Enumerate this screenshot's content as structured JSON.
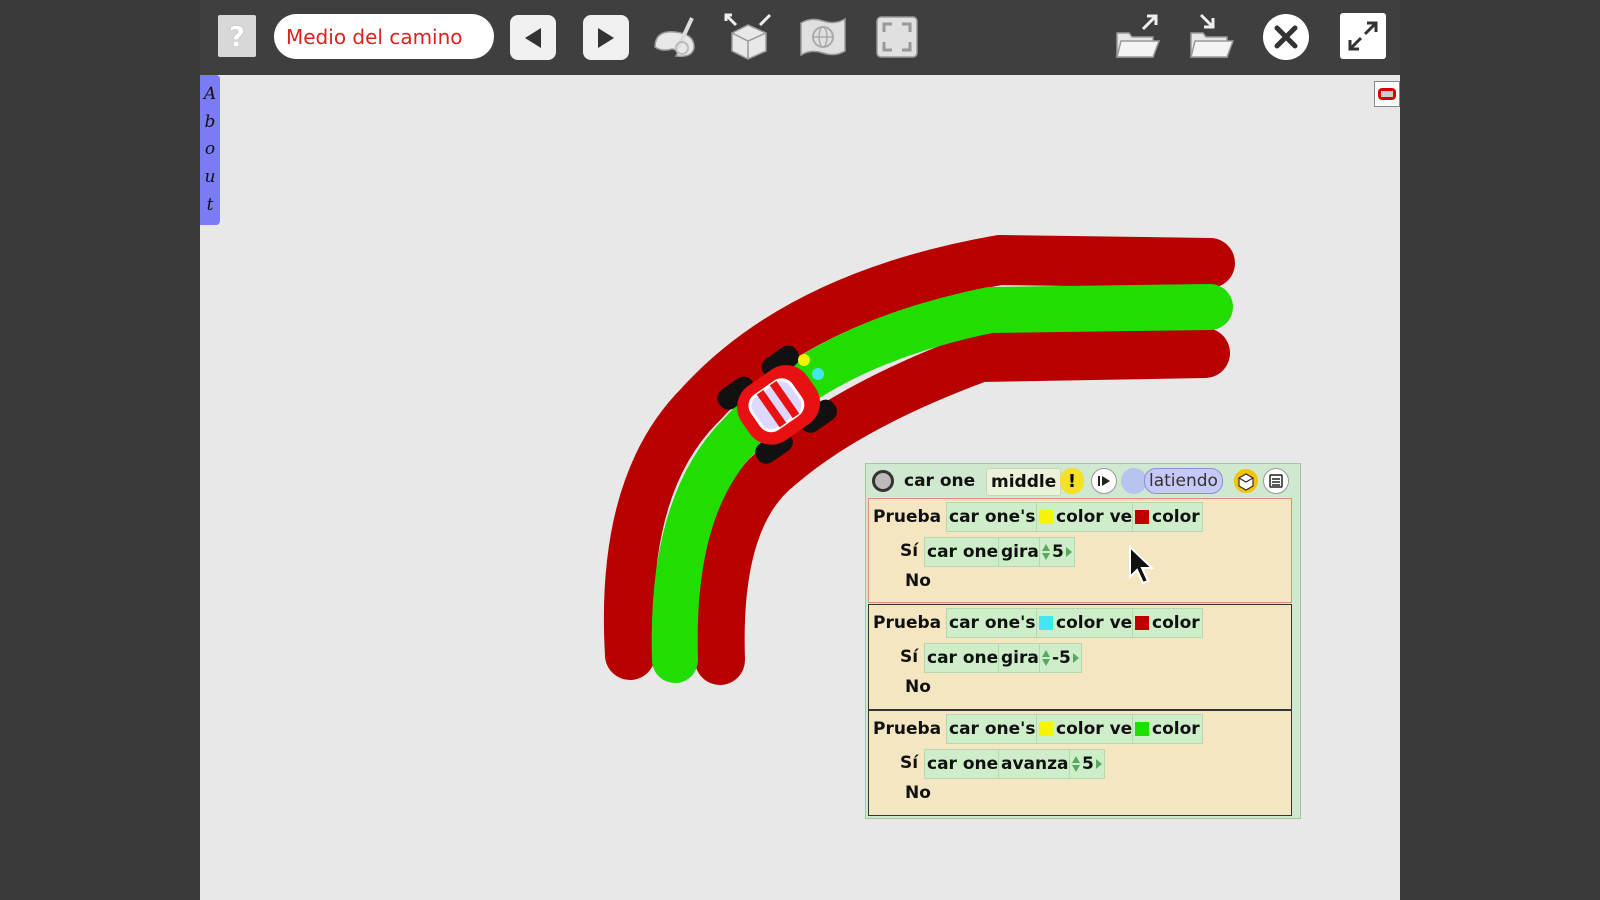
{
  "toolbar": {
    "help_label": "?",
    "project_title": "Medio del camino"
  },
  "world": {
    "about_letters": [
      "A",
      "b",
      "o",
      "u",
      "t"
    ]
  },
  "colors": {
    "road_border": "#b80000",
    "road_center": "#22dd00",
    "sensor_yellow": "#f5f500",
    "sensor_cyan": "#44e6f0",
    "swatch_red": "#c00000",
    "swatch_green": "#22dd00"
  },
  "viewer": {
    "name": "car one",
    "variant": "middle",
    "warning": "!",
    "status": "latiendo",
    "tests": [
      {
        "test_label": "Prueba",
        "cond_subject": "car one's",
        "cond_color": "color ve",
        "cond_color_swatch": "yellow",
        "cond_target": "color",
        "cond_target_swatch": "red",
        "yes_label": "Sí",
        "yes_object": "car one",
        "yes_command": "gira",
        "yes_value": "5",
        "no_label": "No"
      },
      {
        "test_label": "Prueba",
        "cond_subject": "car one's",
        "cond_color": "color ve",
        "cond_color_swatch": "cyan",
        "cond_target": "color",
        "cond_target_swatch": "red",
        "yes_label": "Sí",
        "yes_object": "car one",
        "yes_command": "gira",
        "yes_value": "-5",
        "no_label": "No"
      },
      {
        "test_label": "Prueba",
        "cond_subject": "car one's",
        "cond_color": "color ve",
        "cond_color_swatch": "yellow",
        "cond_target": "color",
        "cond_target_swatch": "green",
        "yes_label": "Sí",
        "yes_object": "car one",
        "yes_command": "avanza",
        "yes_value": "5",
        "no_label": "No"
      }
    ]
  },
  "icons": [
    "help-icon",
    "back-arrow-icon",
    "forward-arrow-icon",
    "paint-palette-icon",
    "supplies-box-icon",
    "world-icon",
    "fullscreen-frame-icon",
    "open-folder-icon",
    "save-folder-icon",
    "close-icon",
    "expand-icon",
    "mouse-cursor-icon"
  ]
}
